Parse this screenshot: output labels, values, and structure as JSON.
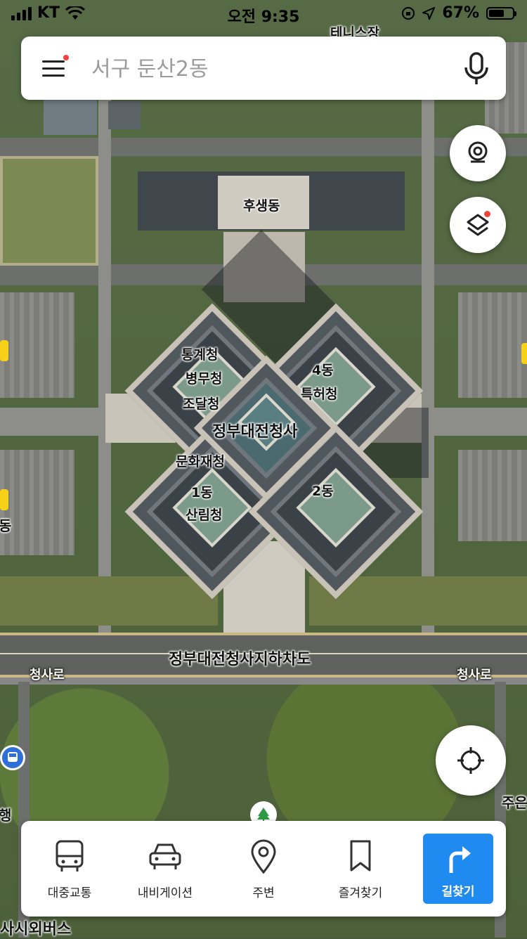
{
  "status_bar": {
    "carrier": "KT",
    "time": "오전 9:35",
    "battery": "67%",
    "battery_level": 0.67
  },
  "search": {
    "placeholder": "서구 둔산2동",
    "value": ""
  },
  "map": {
    "labels": {
      "top_building": "테니스장",
      "welfare": "후생동",
      "stats": "통계청",
      "military": "병무청",
      "procurement": "조달청",
      "dong4": "4동",
      "patent": "특허청",
      "complex": "정부대전청사",
      "heritage": "문화재청",
      "dong1": "1동",
      "forest": "산림청",
      "dong2": "2동",
      "underpass": "정부대전청사지하차도",
      "road_left": "청사로",
      "road_right": "청사로",
      "edge_left_top": "동",
      "edge_left_mid": "행",
      "edge_right": "주은",
      "bottom_left": "사시외버스"
    }
  },
  "bottom_nav": {
    "transit": "대중교통",
    "navigation": "내비게이션",
    "nearby": "주변",
    "favorites": "즐겨찾기",
    "directions": "길찾기"
  },
  "colors": {
    "accent": "#1f8af0",
    "notification_dot": "#f0433a",
    "poi_yellow": "#f6d117",
    "bus_blue": "#2f6fd8"
  },
  "icons": {
    "menu": "hamburger-menu-icon",
    "mic": "microphone-icon",
    "street_view": "street-view-camera-icon",
    "layers": "layers-icon",
    "locate": "current-location-icon",
    "bus": "bus-icon",
    "car": "car-icon",
    "pin": "location-pin-icon",
    "bookmark": "bookmark-icon",
    "turn": "turn-right-arrow-icon",
    "tree": "tree-icon"
  }
}
